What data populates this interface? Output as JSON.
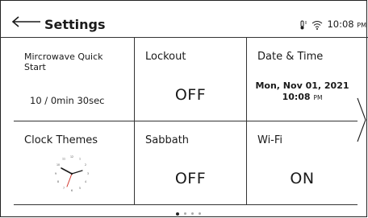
{
  "header": {
    "title": "Settings",
    "status": {
      "time": "10:08",
      "ampm": "PM",
      "icons": [
        "remote-thermometer-icon",
        "wifi-icon"
      ]
    }
  },
  "tiles": [
    {
      "label": "Mircrowave Quick Start",
      "value": "10 / 0min 30sec"
    },
    {
      "label": "Lockout",
      "value": "OFF"
    },
    {
      "label": "Date & Time",
      "date": "Mon, Nov 01, 2021",
      "time": "10:08",
      "ampm": "PM"
    },
    {
      "label": "Clock Themes",
      "value_icon": "analog-clock-icon"
    },
    {
      "label": "Sabbath",
      "value": "OFF"
    },
    {
      "label": "Wi-Fi",
      "value": "ON"
    }
  ],
  "pagination": {
    "pages": 4,
    "current": 1
  },
  "colors": {
    "hand": "#d0362c",
    "line": "#333333",
    "text": "#1a1a1a"
  }
}
